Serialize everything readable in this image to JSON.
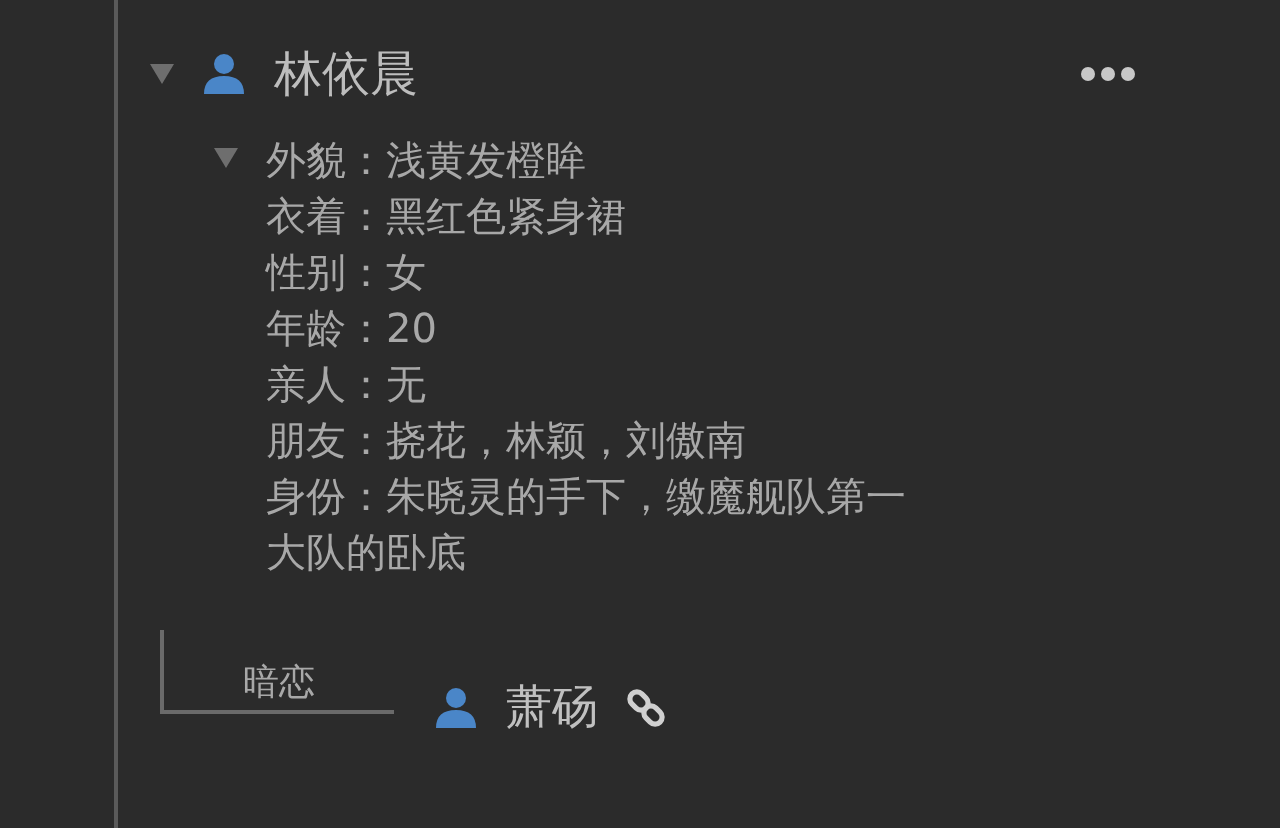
{
  "node": {
    "name": "林依晨",
    "expanded": true,
    "details": {
      "expanded": true,
      "lines": [
        "外貌：浅黄发橙眸",
        "衣着：黑红色紧身裙",
        "性别：女",
        "年龄：20",
        "亲人：无",
        "朋友：挠花，林颖，刘傲南",
        "身份：朱晓灵的手下，缴魔舰队第一大队的卧底"
      ]
    },
    "relation": {
      "label": "暗恋",
      "target": "萧砀",
      "linked": true
    }
  }
}
